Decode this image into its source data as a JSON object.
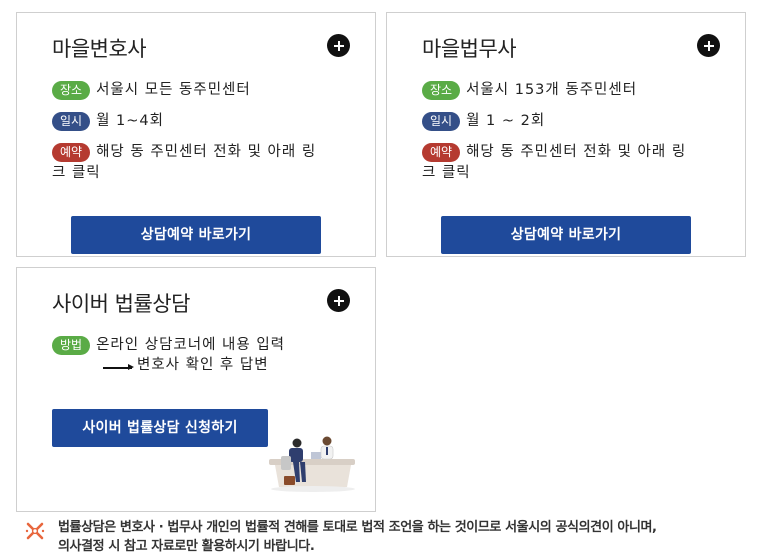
{
  "cards": [
    {
      "title": "마을변호사",
      "place_badge": "장소",
      "place_text": "서울시 모든 동주민센터",
      "date_badge": "일시",
      "date_text": "월 1~4회",
      "reserve_badge": "예약",
      "reserve_line1": "해당 동 주민센터 전화 및 아래 링",
      "reserve_line2": "크 클릭",
      "button_label": "상담예약 바로가기"
    },
    {
      "title": "마을법무사",
      "place_badge": "장소",
      "place_text": "서울시 153개 동주민센터",
      "date_badge": "일시",
      "date_text": "월 1 ~ 2회",
      "reserve_badge": "예약",
      "reserve_line1": "해당 동 주민센터 전화 및 아래 링",
      "reserve_line2": "크 클릭",
      "button_label": "상담예약 바로가기"
    },
    {
      "title": "사이버 법률상담",
      "method_badge": "방법",
      "method_text": "온라인 상담코너에 내용 입력",
      "method_text2": "변호사 확인 후 답변",
      "button_label": "사이버 법률상담 신청하기"
    }
  ],
  "notice": {
    "line1": "법률상담은 변호사 · 법무사 개인의 법률적 견해를 토대로 법적 조언을 하는 것이므로 서울시의  공식의견이 아니며,",
    "line2": "의사결정 시  참고 자료로만 활용하시기 바랍니다."
  },
  "colors": {
    "badge_place": "#5aab46",
    "badge_date": "#344f88",
    "badge_reserve": "#b53a30",
    "button": "#1f4a9b",
    "notice_icon": "#e8663d"
  },
  "icons": [
    "plus-circle-icon",
    "arrow-right-icon",
    "consultation-illustration",
    "notice-x-icon"
  ]
}
